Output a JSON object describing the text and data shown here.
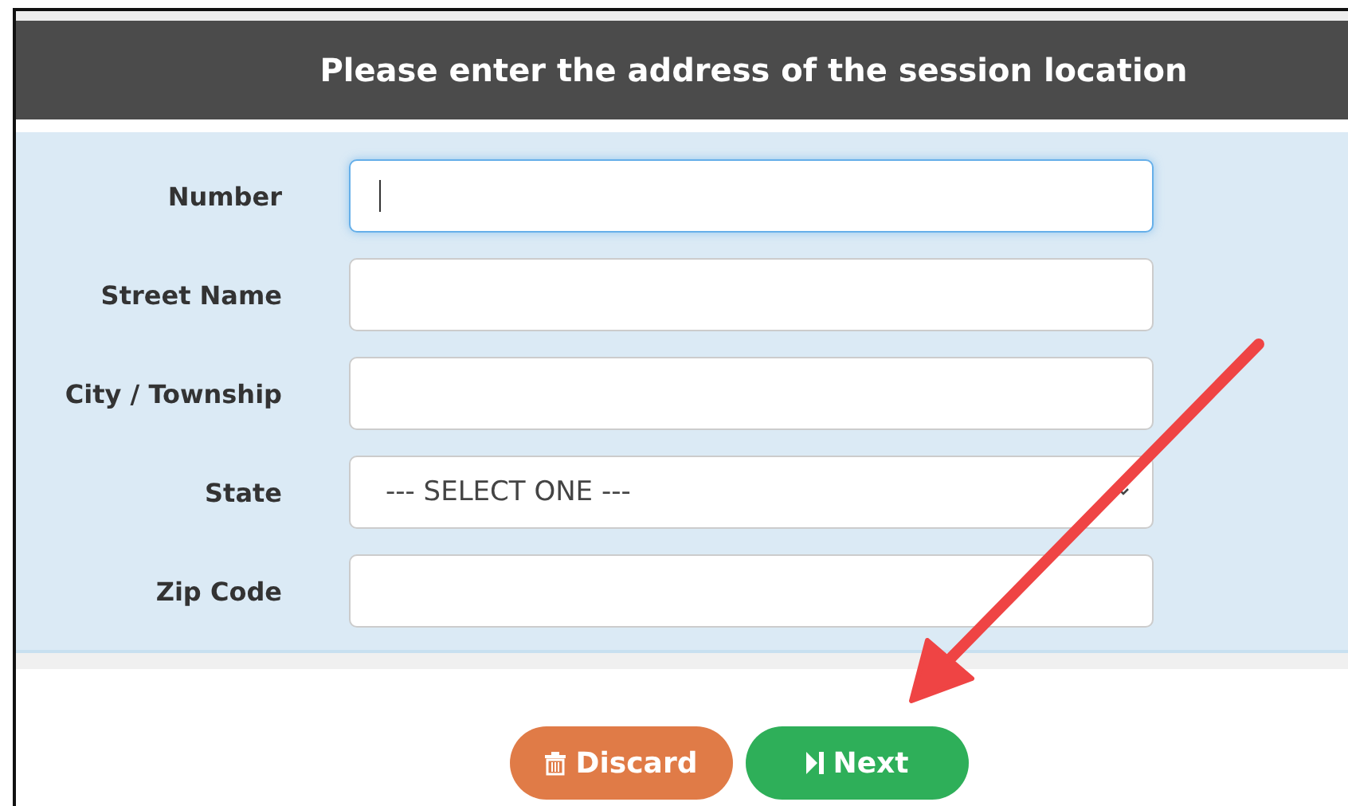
{
  "header": {
    "title": "Please enter the address of the session location"
  },
  "fields": [
    {
      "label": "Number",
      "kind": "text",
      "focused": true
    },
    {
      "label": "Street Name",
      "kind": "text",
      "focused": false
    },
    {
      "label": "City / Township",
      "kind": "text",
      "focused": false
    },
    {
      "label": "State",
      "kind": "select",
      "value": "--- SELECT ONE ---",
      "focused": false
    },
    {
      "label": "Zip Code",
      "kind": "text",
      "focused": false
    }
  ],
  "buttons": [
    {
      "label": "Discard",
      "kind": "discard"
    },
    {
      "label": "Next",
      "kind": "next"
    }
  ]
}
